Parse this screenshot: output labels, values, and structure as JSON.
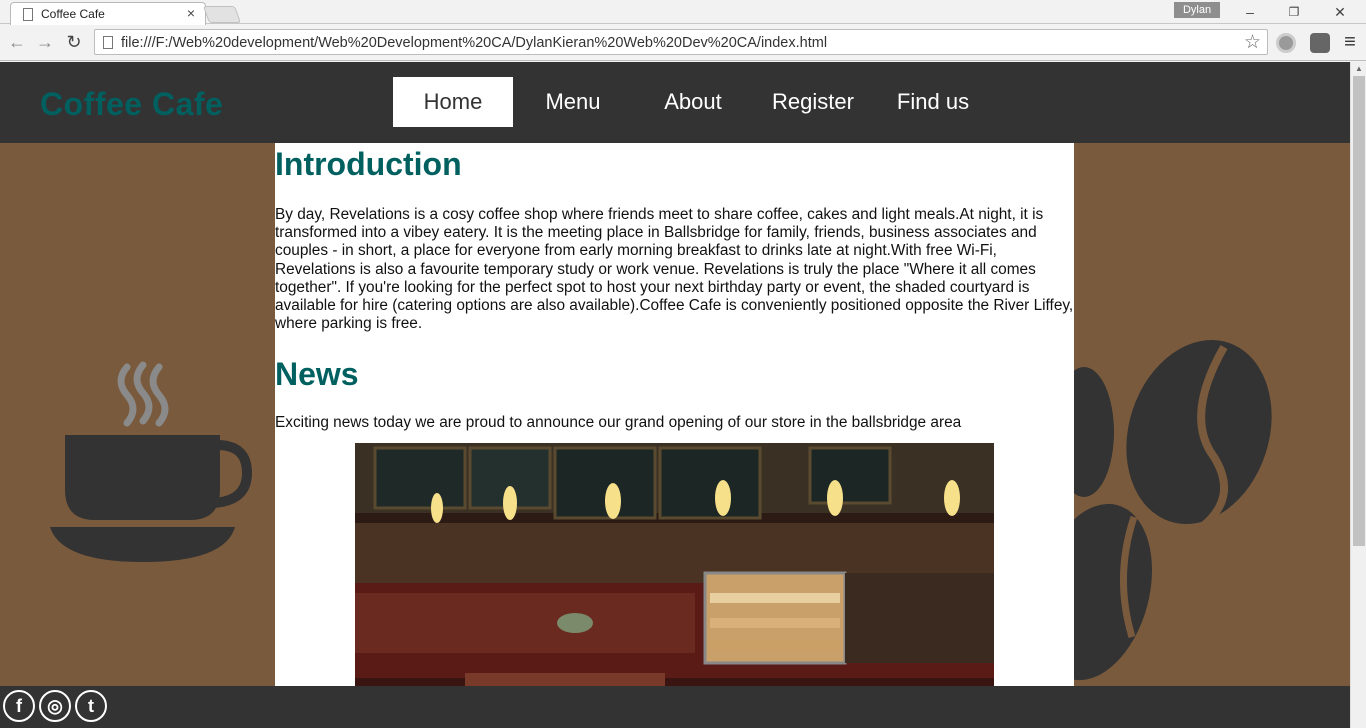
{
  "browser": {
    "tab_title": "Coffee Cafe",
    "tab_close": "×",
    "profile_name": "Dylan",
    "url": "file:///F:/Web%20development/Web%20Development%20CA/DylanKieran%20Web%20Dev%20CA/index.html",
    "window": {
      "minimize": "–",
      "restore": "❐",
      "close": "✕"
    },
    "nav": {
      "back": "←",
      "forward": "→",
      "reload": "↻",
      "menu": "≡"
    },
    "star": "☆"
  },
  "site": {
    "logo": "Coffee Cafe",
    "nav": [
      {
        "label": "Home",
        "active": true
      },
      {
        "label": "Menu",
        "active": false
      },
      {
        "label": "About",
        "active": false
      },
      {
        "label": "Register",
        "active": false
      },
      {
        "label": "Find us",
        "active": false
      }
    ],
    "intro": {
      "heading": "Introduction",
      "text": "By day, Revelations is a cosy coffee shop where friends meet to share coffee, cakes and light meals.At night, it is transformed into a vibey eatery. It is the meeting place in Ballsbridge for family, friends, business associates and couples - in short, a place for everyone from early morning breakfast to drinks late at night.With free Wi-Fi, Revelations is also a favourite temporary study or work venue. Revelations is truly the place \"Where it all comes together\". If you're looking for the perfect spot to host your next birthday party or event, the shaded courtyard is available for hire (catering options are also available).Coffee Cafe is conveniently positioned opposite the River Liffey, where parking is free."
    },
    "news": {
      "heading": "News",
      "text": "Exciting news today we are proud to announce our grand opening of our store in the ballsbridge area"
    },
    "social": [
      {
        "name": "facebook",
        "glyph": "f"
      },
      {
        "name": "instagram",
        "glyph": "◎"
      },
      {
        "name": "twitter",
        "glyph": "t"
      }
    ]
  },
  "colors": {
    "header": "#333333",
    "brand": "#006060",
    "page_bg": "#7a5a3c"
  }
}
